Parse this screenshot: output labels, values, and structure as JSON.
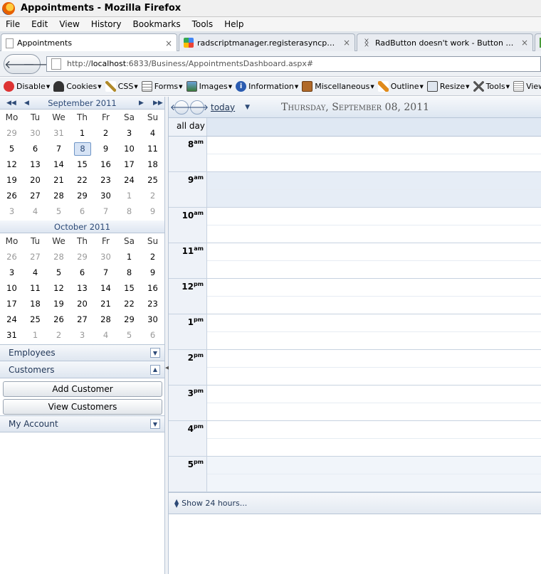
{
  "window": {
    "title": "Appointments - Mozilla Firefox"
  },
  "menu": [
    "File",
    "Edit",
    "View",
    "History",
    "Bookmarks",
    "Tools",
    "Help"
  ],
  "tabs": [
    {
      "label": "Appointments",
      "close": "×"
    },
    {
      "label": "radscriptmanager.registerasyncpostback…",
      "close": "×"
    },
    {
      "label": "RadButton doesn't work - Button Forum -…",
      "close": "×"
    }
  ],
  "nav": {
    "back": "🡐",
    "forward": "🡒"
  },
  "url": {
    "prefix": "http://",
    "host": "localhost",
    "rest": ":6833/Business/AppointmentsDashboard.aspx#"
  },
  "devtoolbar": [
    "Disable",
    "Cookies",
    "CSS",
    "Forms",
    "Images",
    "Information",
    "Miscellaneous",
    "Outline",
    "Resize",
    "Tools",
    "View Source"
  ],
  "calendar": {
    "nav_first": "◀◀",
    "nav_prev": "◀",
    "nav_next": "▶",
    "nav_last": "▶▶",
    "dow": [
      "Mo",
      "Tu",
      "We",
      "Th",
      "Fr",
      "Sa",
      "Su"
    ],
    "months": [
      {
        "title": "September 2011",
        "weeks": [
          [
            "29",
            "30",
            "31",
            "1",
            "2",
            "3",
            "4"
          ],
          [
            "5",
            "6",
            "7",
            "8",
            "9",
            "10",
            "11"
          ],
          [
            "12",
            "13",
            "14",
            "15",
            "16",
            "17",
            "18"
          ],
          [
            "19",
            "20",
            "21",
            "22",
            "23",
            "24",
            "25"
          ],
          [
            "26",
            "27",
            "28",
            "29",
            "30",
            "1",
            "2"
          ],
          [
            "3",
            "4",
            "5",
            "6",
            "7",
            "8",
            "9"
          ]
        ]
      },
      {
        "title": "October 2011",
        "weeks": [
          [
            "26",
            "27",
            "28",
            "29",
            "30",
            "1",
            "2"
          ],
          [
            "3",
            "4",
            "5",
            "6",
            "7",
            "8",
            "9"
          ],
          [
            "10",
            "11",
            "12",
            "13",
            "14",
            "15",
            "16"
          ],
          [
            "17",
            "18",
            "19",
            "20",
            "21",
            "22",
            "23"
          ],
          [
            "24",
            "25",
            "26",
            "27",
            "28",
            "29",
            "30"
          ],
          [
            "31",
            "1",
            "2",
            "3",
            "4",
            "5",
            "6"
          ]
        ]
      }
    ]
  },
  "panels": {
    "employees": "Employees",
    "customers": "Customers",
    "add_customer": "Add Customer",
    "view_customers": "View Customers",
    "my_account": "My Account"
  },
  "scheduler": {
    "today": "today",
    "date": "Thursday, September 08, 2011",
    "all_day": "all day",
    "hours": [
      {
        "h": "8",
        "ap": "am"
      },
      {
        "h": "9",
        "ap": "am"
      },
      {
        "h": "10",
        "ap": "am"
      },
      {
        "h": "11",
        "ap": "am"
      },
      {
        "h": "12",
        "ap": "pm"
      },
      {
        "h": "1",
        "ap": "pm"
      },
      {
        "h": "2",
        "ap": "pm"
      },
      {
        "h": "3",
        "ap": "pm"
      },
      {
        "h": "4",
        "ap": "pm"
      },
      {
        "h": "5",
        "ap": "pm"
      }
    ],
    "show24": "Show 24 hours..."
  }
}
